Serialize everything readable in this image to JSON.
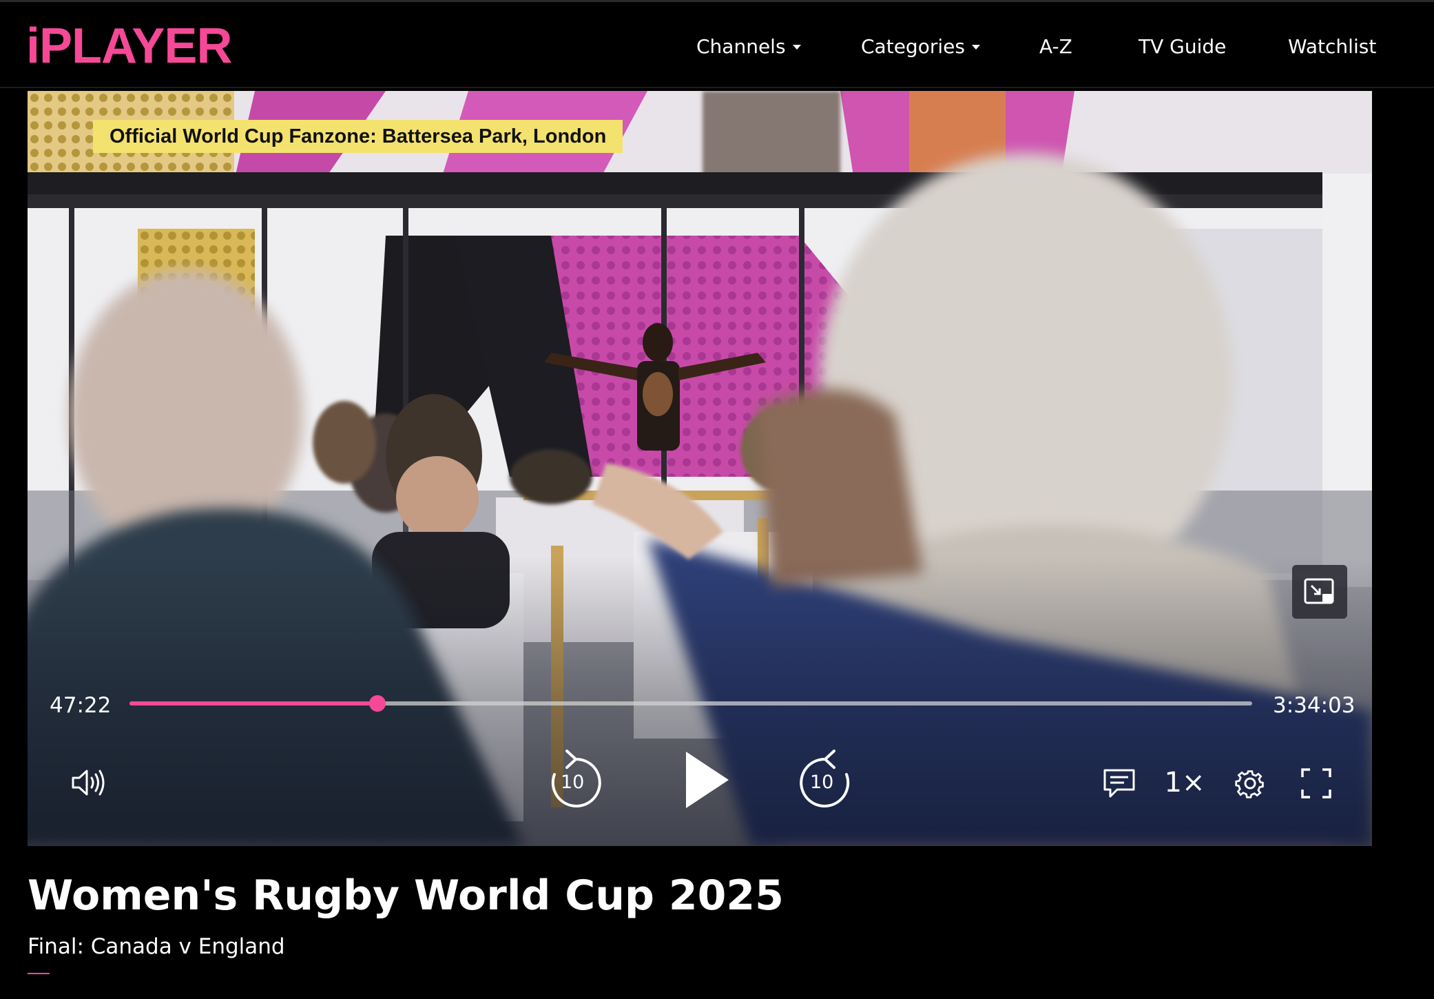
{
  "brand": {
    "logo_text": "iPLAYER",
    "accent_color": "#f54997"
  },
  "nav": {
    "items": [
      {
        "label": "Channels",
        "has_dropdown": true
      },
      {
        "label": "Categories",
        "has_dropdown": true
      },
      {
        "label": "A-Z",
        "has_dropdown": false
      },
      {
        "label": "TV Guide",
        "has_dropdown": false
      },
      {
        "label": "Watchlist",
        "has_dropdown": false
      }
    ]
  },
  "video": {
    "caption": "Official World Cup Fanzone: Battersea Park, London"
  },
  "player": {
    "current_time": "47:22",
    "total_time": "3:34:03",
    "progress_fraction": 0.221,
    "skip_back_seconds": "10",
    "skip_forward_seconds": "10",
    "speed_label": "1×",
    "icons": {
      "volume": "volume-icon",
      "skip_back": "skip-back-10-icon",
      "play": "play-icon",
      "skip_forward": "skip-forward-10-icon",
      "subtitles": "subtitles-icon",
      "settings": "gear-icon",
      "fullscreen": "fullscreen-icon",
      "picture_in_picture": "picture-in-picture-icon"
    }
  },
  "programme": {
    "title": "Women's Rugby World Cup 2025",
    "subtitle": "Final: Canada v England"
  }
}
